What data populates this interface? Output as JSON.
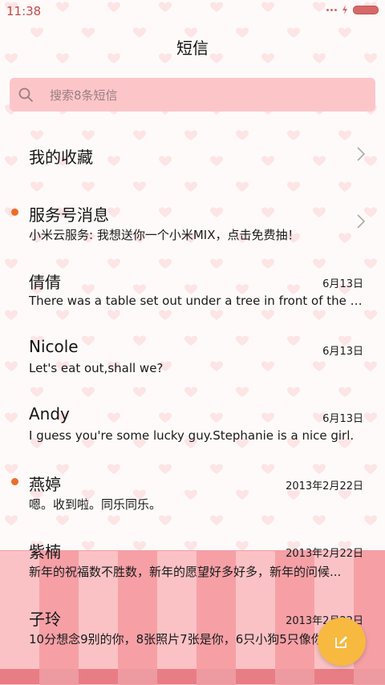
{
  "status_bar": {
    "time": "11:38"
  },
  "header": {
    "title": "短信"
  },
  "search": {
    "placeholder": "搜索8条短信"
  },
  "favorites": {
    "label": "我的收藏"
  },
  "service": {
    "name": "服务号消息",
    "preview": "小米云服务: 我想送你一个小米MIX，点击免费抽！",
    "unread": true
  },
  "conversations": [
    {
      "name": "倩倩",
      "preview": "There was a table set out under a tree in front of the ho...",
      "date": "6月13日"
    },
    {
      "name": "Nicole",
      "preview": "Let's eat out,shall we?",
      "date": "6月13日"
    },
    {
      "name": "Andy",
      "preview": "I guess you're some lucky guy.Stephanie is a nice girl.",
      "date": "6月13日"
    },
    {
      "name": "燕婷",
      "preview": "嗯。收到啦。同乐同乐。",
      "date": "2013年2月22日",
      "unread": true
    },
    {
      "name": "紫楠",
      "preview": "新年的祝福数不胜数，新年的愿望好多好多，新年的问候...",
      "date": "2013年2月22日"
    },
    {
      "name": "子玲",
      "preview": "10分想念9别的你，8张照片7张是你，6只小狗5只像你...",
      "date": "2013年2月22日"
    }
  ],
  "colors": {
    "accent": "#ec6c2a",
    "fab": "#f7b93f",
    "search_bg": "#fcc6c9"
  },
  "icons": {
    "search": "search-icon",
    "compose": "compose-icon",
    "chevron": "chevron-right-icon"
  }
}
